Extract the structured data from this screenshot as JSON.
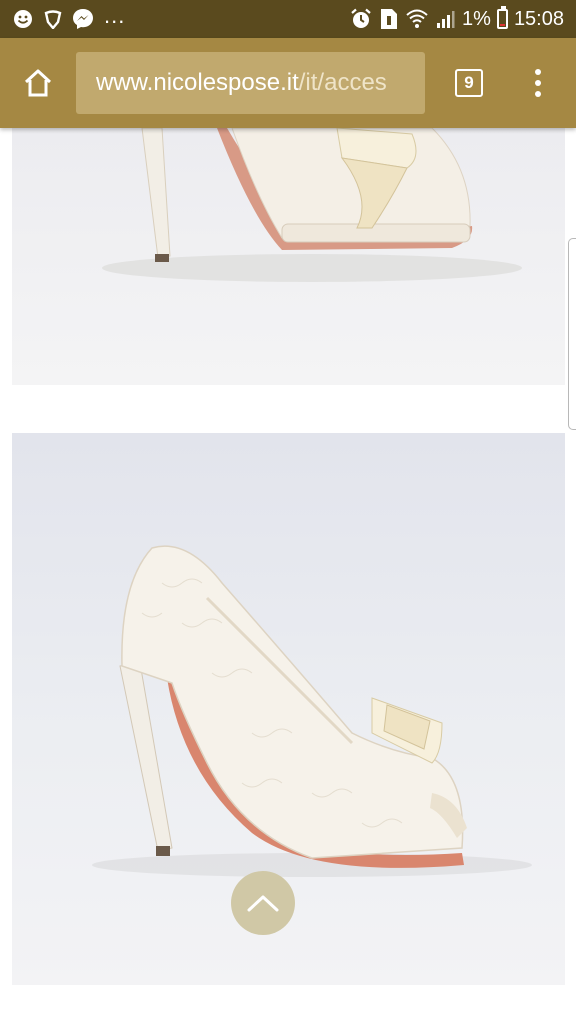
{
  "status_bar": {
    "notification_icons": [
      "emoji-icon",
      "shield-icon",
      "messenger-icon"
    ],
    "more": "...",
    "right_icons": [
      "alarm-icon",
      "sim-icon",
      "wifi-icon",
      "signal-icon"
    ],
    "battery": "1%",
    "time": "15:08"
  },
  "browser": {
    "url_host": "www.nicolespose.it",
    "url_path": "/it/acces",
    "tab_count": "9"
  },
  "products": [
    {
      "name": "bridal-shoe-satin-bow"
    },
    {
      "name": "bridal-shoe-lace-bow"
    }
  ],
  "colors": {
    "status_bar": "#5a4a1e",
    "toolbar": "#a58843",
    "url_box": "#c1a96e",
    "back_to_top": "#d0c8a6"
  }
}
